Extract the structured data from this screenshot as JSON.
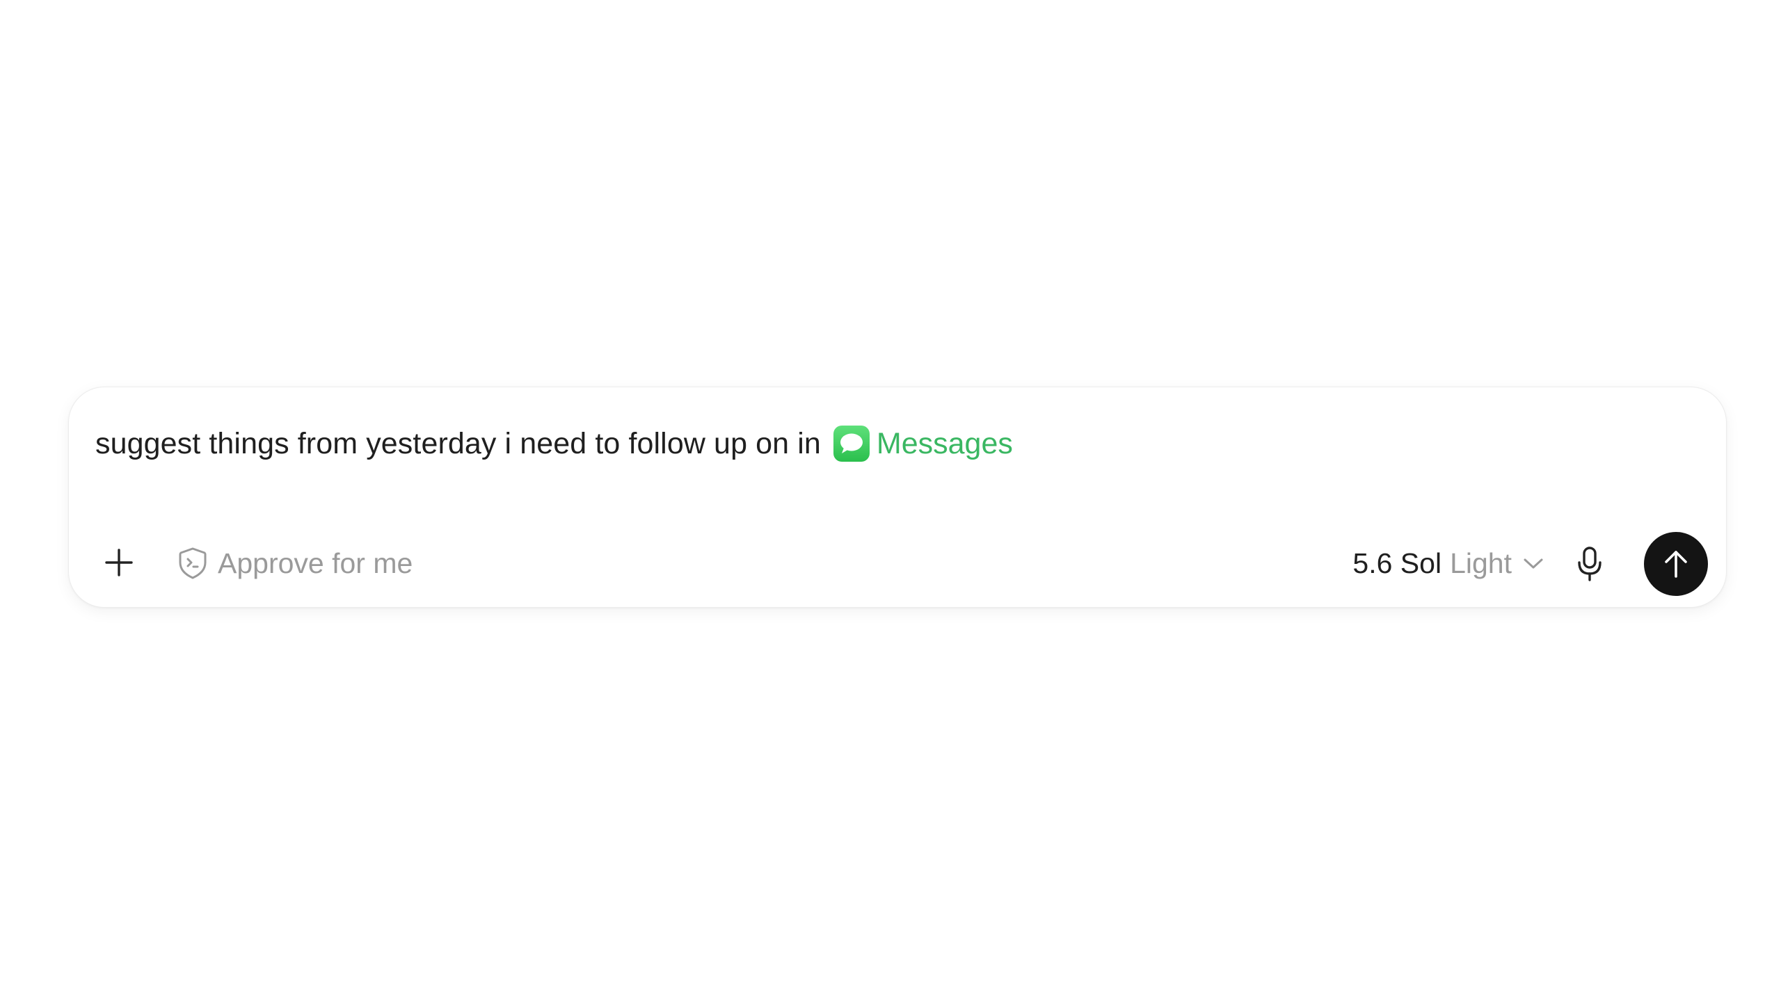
{
  "composer": {
    "prompt_text": "suggest things from yesterday i need to follow up on in",
    "mention": {
      "app_name": "Messages",
      "icon": "messages-app-icon",
      "color": "#3ab762"
    }
  },
  "toolbar": {
    "add_icon": "plus-icon",
    "approve": {
      "icon": "shield-icon",
      "label": "Approve for me"
    },
    "model": {
      "name": "5.6 Sol",
      "variant": "Light",
      "icon": "chevron-down-icon"
    },
    "mic_icon": "microphone-icon",
    "send_icon": "arrow-up-icon",
    "send_color": "#141414"
  }
}
